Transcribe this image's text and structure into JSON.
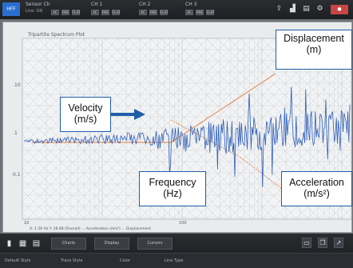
{
  "topbar": {
    "logo": "HFF",
    "channels": [
      {
        "name": "Sensor Ch",
        "sub": "Live: ON",
        "buttons": [
          "AC",
          "PRE",
          "FLAT"
        ]
      },
      {
        "name": "CH 1",
        "sub": "",
        "buttons": [
          "AC",
          "PRE",
          "FLAT"
        ]
      },
      {
        "name": "CH 2",
        "sub": "",
        "buttons": [
          "AC",
          "PRE",
          "FLAT"
        ]
      },
      {
        "name": "CH 3",
        "sub": "",
        "buttons": [
          "AC",
          "PRE",
          "FLAT"
        ]
      }
    ]
  },
  "plot": {
    "title": "Tripartite Spectrum Plot",
    "y_ticks": [
      "10",
      "1",
      "0.1"
    ],
    "x_ticks": [
      "10",
      "100"
    ],
    "status": "X: 1.59 Hz  Y: 26.68 (Overall)  ...  Acceleration (m/s²)  ...  Displacement"
  },
  "callouts": {
    "displacement": [
      "Displacement",
      "(m)"
    ],
    "velocity": [
      "Velocity",
      "(m/s)"
    ],
    "frequency": [
      "Frequency",
      "(Hz)"
    ],
    "acceleration": [
      "Acceleration",
      "(m/s²)"
    ]
  },
  "bottombar": {
    "tabs": [
      "Charts",
      "Display",
      "Cursors"
    ],
    "fields": [
      "Default Style",
      "Trace Style",
      "Color",
      "Line Type"
    ]
  },
  "colors": {
    "trace": "#2f5fb8",
    "reference": "#e07a3a",
    "accent": "#1f5fa8"
  }
}
